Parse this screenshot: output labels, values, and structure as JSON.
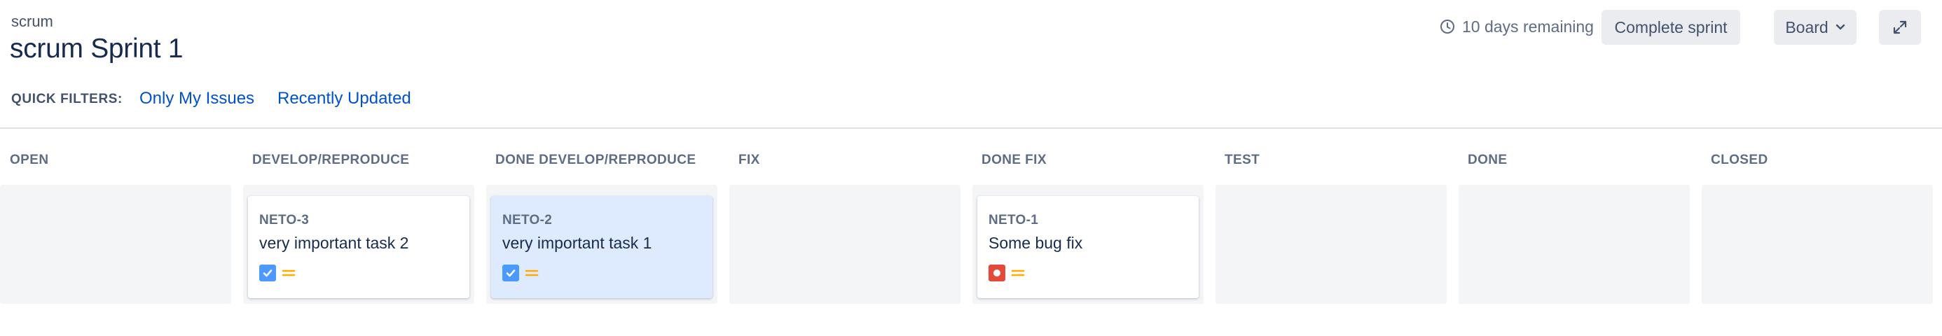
{
  "header": {
    "breadcrumb": "scrum",
    "title": "scrum Sprint 1",
    "remaining": "10 days remaining",
    "complete_button": "Complete sprint",
    "board_button": "Board"
  },
  "quick_filters": {
    "label": "QUICK FILTERS:",
    "items": [
      "Only My Issues",
      "Recently Updated"
    ]
  },
  "columns": [
    {
      "name": "OPEN"
    },
    {
      "name": "DEVELOP/REPRODUCE",
      "card": {
        "key": "NETO-3",
        "summary": "very important task 2",
        "type": "task",
        "priority": "medium"
      }
    },
    {
      "name": "DONE DEVELOP/REPRODUCE",
      "card": {
        "key": "NETO-2",
        "summary": "very important task 1",
        "type": "task",
        "priority": "medium"
      }
    },
    {
      "name": "FIX"
    },
    {
      "name": "DONE FIX",
      "card": {
        "key": "NETO-1",
        "summary": "Some bug fix",
        "type": "bug",
        "priority": "medium"
      }
    },
    {
      "name": "TEST"
    },
    {
      "name": "DONE"
    },
    {
      "name": "CLOSED"
    }
  ],
  "colors": {
    "link": "#0052cc",
    "task_icon": "#4c9aff",
    "bug_icon": "#e5493a",
    "priority_medium": "#ffab00",
    "selected_card": "#deebff",
    "column_bg": "#f4f5f7"
  },
  "icons": {
    "clock": "clock-icon",
    "chevron": "chevron-down-icon",
    "expand": "expand-icon",
    "task": "task-checkbox-icon",
    "bug": "bug-icon",
    "priority": "priority-medium-icon"
  }
}
